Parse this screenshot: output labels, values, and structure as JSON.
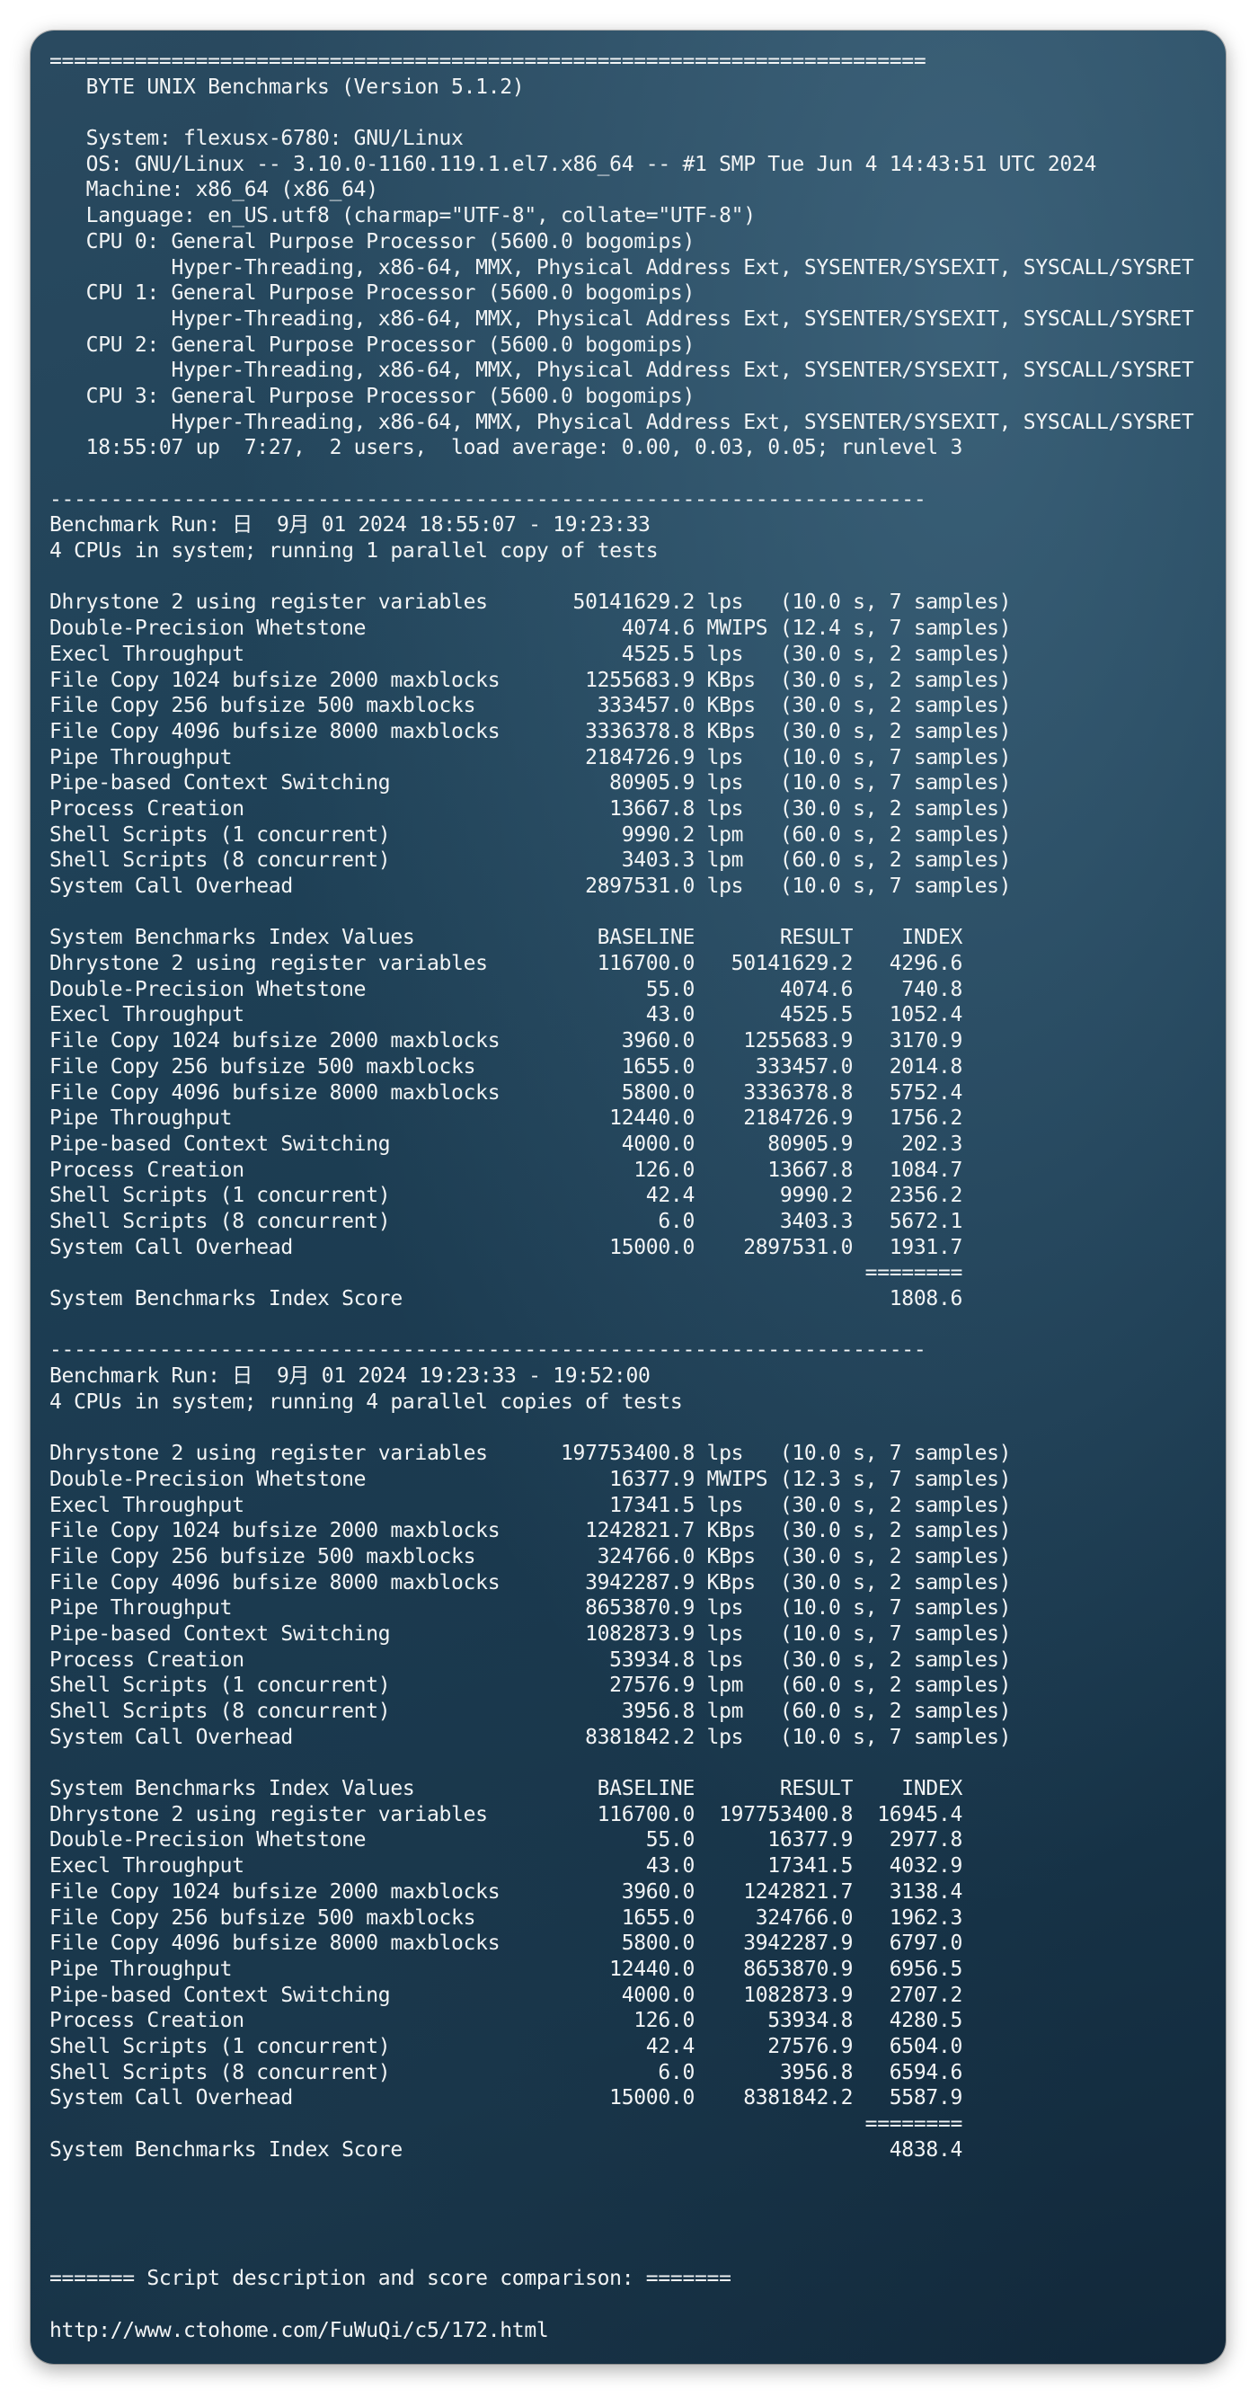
{
  "terminal": {
    "lines": [
      "========================================================================",
      "   BYTE UNIX Benchmarks (Version 5.1.2)",
      "",
      "   System: flexusx-6780: GNU/Linux",
      "   OS: GNU/Linux -- 3.10.0-1160.119.1.el7.x86_64 -- #1 SMP Tue Jun 4 14:43:51 UTC 2024",
      "   Machine: x86_64 (x86_64)",
      "   Language: en_US.utf8 (charmap=\"UTF-8\", collate=\"UTF-8\")",
      "   CPU 0: General Purpose Processor (5600.0 bogomips)",
      "          Hyper-Threading, x86-64, MMX, Physical Address Ext, SYSENTER/SYSEXIT, SYSCALL/SYSRET",
      "   CPU 1: General Purpose Processor (5600.0 bogomips)",
      "          Hyper-Threading, x86-64, MMX, Physical Address Ext, SYSENTER/SYSEXIT, SYSCALL/SYSRET",
      "   CPU 2: General Purpose Processor (5600.0 bogomips)",
      "          Hyper-Threading, x86-64, MMX, Physical Address Ext, SYSENTER/SYSEXIT, SYSCALL/SYSRET",
      "   CPU 3: General Purpose Processor (5600.0 bogomips)",
      "          Hyper-Threading, x86-64, MMX, Physical Address Ext, SYSENTER/SYSEXIT, SYSCALL/SYSRET",
      "   18:55:07 up  7:27,  2 users,  load average: 0.00, 0.03, 0.05; runlevel 3",
      "",
      "------------------------------------------------------------------------",
      "Benchmark Run: 日  9月 01 2024 18:55:07 - 19:23:33",
      "4 CPUs in system; running 1 parallel copy of tests",
      "",
      "Dhrystone 2 using register variables       50141629.2 lps   (10.0 s, 7 samples)",
      "Double-Precision Whetstone                     4074.6 MWIPS (12.4 s, 7 samples)",
      "Execl Throughput                               4525.5 lps   (30.0 s, 2 samples)",
      "File Copy 1024 bufsize 2000 maxblocks       1255683.9 KBps  (30.0 s, 2 samples)",
      "File Copy 256 bufsize 500 maxblocks          333457.0 KBps  (30.0 s, 2 samples)",
      "File Copy 4096 bufsize 8000 maxblocks       3336378.8 KBps  (30.0 s, 2 samples)",
      "Pipe Throughput                             2184726.9 lps   (10.0 s, 7 samples)",
      "Pipe-based Context Switching                  80905.9 lps   (10.0 s, 7 samples)",
      "Process Creation                              13667.8 lps   (30.0 s, 2 samples)",
      "Shell Scripts (1 concurrent)                   9990.2 lpm   (60.0 s, 2 samples)",
      "Shell Scripts (8 concurrent)                   3403.3 lpm   (60.0 s, 2 samples)",
      "System Call Overhead                        2897531.0 lps   (10.0 s, 7 samples)",
      "",
      "System Benchmarks Index Values               BASELINE       RESULT    INDEX",
      "Dhrystone 2 using register variables         116700.0   50141629.2   4296.6",
      "Double-Precision Whetstone                       55.0       4074.6    740.8",
      "Execl Throughput                                 43.0       4525.5   1052.4",
      "File Copy 1024 bufsize 2000 maxblocks          3960.0    1255683.9   3170.9",
      "File Copy 256 bufsize 500 maxblocks            1655.0     333457.0   2014.8",
      "File Copy 4096 bufsize 8000 maxblocks          5800.0    3336378.8   5752.4",
      "Pipe Throughput                               12440.0    2184726.9   1756.2",
      "Pipe-based Context Switching                   4000.0      80905.9    202.3",
      "Process Creation                                126.0      13667.8   1084.7",
      "Shell Scripts (1 concurrent)                     42.4       9990.2   2356.2",
      "Shell Scripts (8 concurrent)                      6.0       3403.3   5672.1",
      "System Call Overhead                          15000.0    2897531.0   1931.7",
      "                                                                   ========",
      "System Benchmarks Index Score                                        1808.6",
      "",
      "------------------------------------------------------------------------",
      "Benchmark Run: 日  9月 01 2024 19:23:33 - 19:52:00",
      "4 CPUs in system; running 4 parallel copies of tests",
      "",
      "Dhrystone 2 using register variables      197753400.8 lps   (10.0 s, 7 samples)",
      "Double-Precision Whetstone                    16377.9 MWIPS (12.3 s, 7 samples)",
      "Execl Throughput                              17341.5 lps   (30.0 s, 2 samples)",
      "File Copy 1024 bufsize 2000 maxblocks       1242821.7 KBps  (30.0 s, 2 samples)",
      "File Copy 256 bufsize 500 maxblocks          324766.0 KBps  (30.0 s, 2 samples)",
      "File Copy 4096 bufsize 8000 maxblocks       3942287.9 KBps  (30.0 s, 2 samples)",
      "Pipe Throughput                             8653870.9 lps   (10.0 s, 7 samples)",
      "Pipe-based Context Switching                1082873.9 lps   (10.0 s, 7 samples)",
      "Process Creation                              53934.8 lps   (30.0 s, 2 samples)",
      "Shell Scripts (1 concurrent)                  27576.9 lpm   (60.0 s, 2 samples)",
      "Shell Scripts (8 concurrent)                   3956.8 lpm   (60.0 s, 2 samples)",
      "System Call Overhead                        8381842.2 lps   (10.0 s, 7 samples)",
      "",
      "System Benchmarks Index Values               BASELINE       RESULT    INDEX",
      "Dhrystone 2 using register variables         116700.0  197753400.8  16945.4",
      "Double-Precision Whetstone                       55.0      16377.9   2977.8",
      "Execl Throughput                                 43.0      17341.5   4032.9",
      "File Copy 1024 bufsize 2000 maxblocks          3960.0    1242821.7   3138.4",
      "File Copy 256 bufsize 500 maxblocks            1655.0     324766.0   1962.3",
      "File Copy 4096 bufsize 8000 maxblocks          5800.0    3942287.9   6797.0",
      "Pipe Throughput                               12440.0    8653870.9   6956.5",
      "Pipe-based Context Switching                   4000.0    1082873.9   2707.2",
      "Process Creation                                126.0      53934.8   4280.5",
      "Shell Scripts (1 concurrent)                     42.4      27576.9   6504.0",
      "Shell Scripts (8 concurrent)                      6.0       3956.8   6594.6",
      "System Call Overhead                          15000.0    8381842.2   5587.9",
      "                                                                   ========",
      "System Benchmarks Index Score                                        4838.4",
      "",
      "",
      "",
      "",
      "======= Script description and score comparison: =======",
      "",
      "http://www.ctohome.com/FuWuQi/c5/172.html"
    ]
  }
}
